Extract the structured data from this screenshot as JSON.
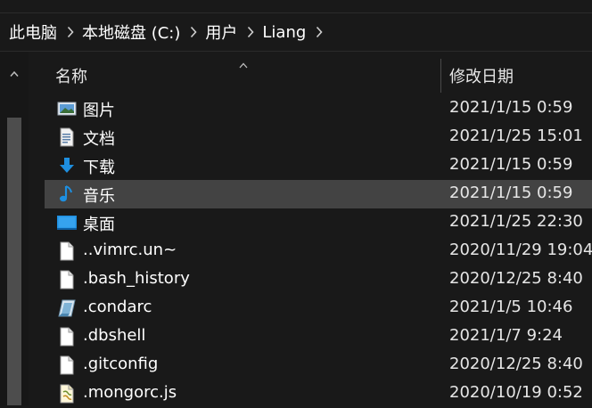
{
  "breadcrumb": {
    "items": [
      "此电脑",
      "本地磁盘 (C:)",
      "用户",
      "Liang"
    ]
  },
  "columns": {
    "name": "名称",
    "date_modified": "修改日期"
  },
  "files": [
    {
      "name": "图片",
      "date": "2021/1/15 0:59",
      "icon": "pictures-folder-icon"
    },
    {
      "name": "文档",
      "date": "2021/1/25 15:01",
      "icon": "documents-folder-icon"
    },
    {
      "name": "下载",
      "date": "2021/1/15 0:59",
      "icon": "downloads-folder-icon"
    },
    {
      "name": "音乐",
      "date": "2021/1/15 0:59",
      "icon": "music-folder-icon"
    },
    {
      "name": "桌面",
      "date": "2021/1/25 22:30",
      "icon": "desktop-folder-icon"
    },
    {
      "name": "..vimrc.un~",
      "date": "2020/11/29 19:04",
      "icon": "file-icon"
    },
    {
      "name": ".bash_history",
      "date": "2020/12/25 8:40",
      "icon": "file-icon"
    },
    {
      "name": ".condarc",
      "date": "2021/1/5 10:46",
      "icon": "config-file-icon"
    },
    {
      "name": ".dbshell",
      "date": "2021/1/7 9:24",
      "icon": "file-icon"
    },
    {
      "name": ".gitconfig",
      "date": "2020/12/25 8:40",
      "icon": "file-icon"
    },
    {
      "name": ".mongorc.js",
      "date": "2020/10/19 0:52",
      "icon": "script-file-icon"
    }
  ],
  "selected_file": "音乐",
  "colors": {
    "background": "#191919",
    "selected_row": "#434343",
    "scrollbar_thumb": "#4d4d4d",
    "folder_blue": "#1e8fe0"
  }
}
